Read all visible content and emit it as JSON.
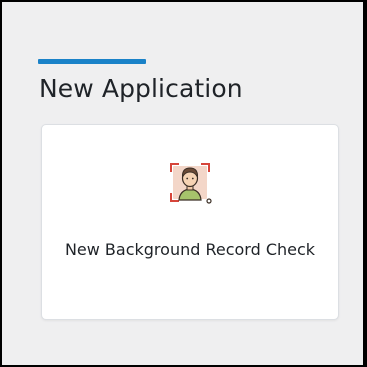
{
  "section": {
    "title": "New Application",
    "accent_color": "#1a82c8"
  },
  "cards": [
    {
      "label": "New Background Record Check",
      "icon": "person-scan-icon"
    }
  ]
}
